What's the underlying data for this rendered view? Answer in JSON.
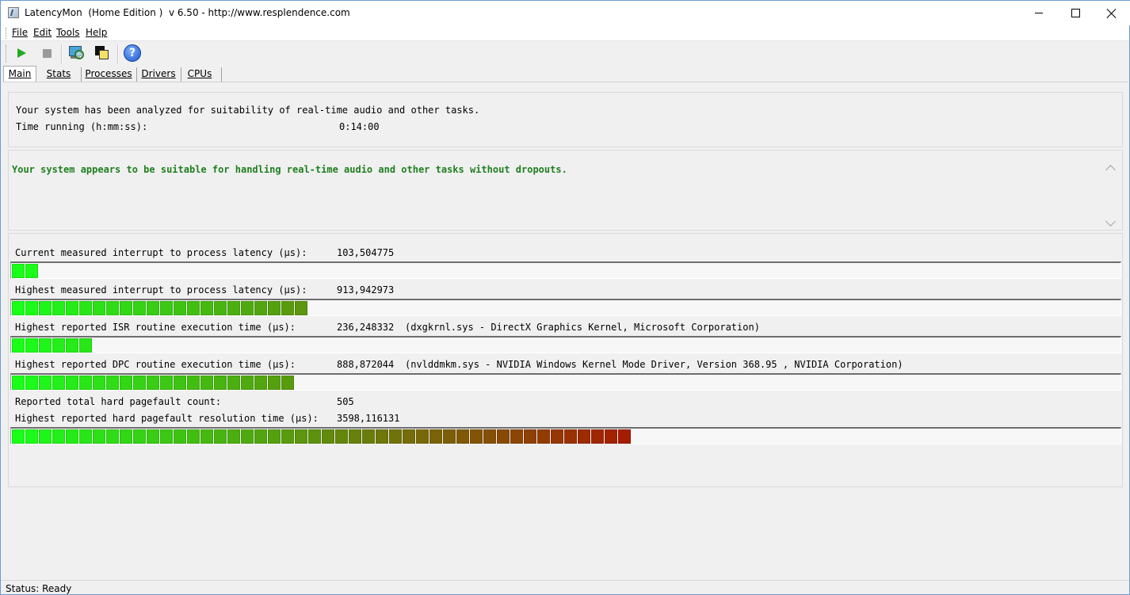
{
  "window": {
    "title": "LatencyMon  (Home Edition )  v 6.50 - http://www.resplendence.com"
  },
  "menu": [
    {
      "label": "File"
    },
    {
      "label": "Edit"
    },
    {
      "label": "Tools"
    },
    {
      "label": "Help"
    }
  ],
  "toolbar": {
    "buttons": [
      {
        "icon": "play-icon"
      },
      {
        "icon": "stop-icon"
      },
      {
        "icon": "monitor-magnifier-icon"
      },
      {
        "icon": "windows-icon"
      },
      {
        "icon": "help-icon",
        "glyph": "?"
      }
    ]
  },
  "tabs": [
    {
      "label": "Main",
      "active": true
    },
    {
      "label": "Stats"
    },
    {
      "label": "Processes"
    },
    {
      "label": "Drivers"
    },
    {
      "label": "CPUs"
    }
  ],
  "summary": {
    "analyzed_text": "Your system has been analyzed for suitability of real-time audio and other tasks.",
    "time_running_label": "Time running (h:mm:ss):",
    "time_running_value": "0:14:00"
  },
  "verdict": {
    "text": "Your system appears to be suitable for handling real-time audio and other tasks without dropouts.",
    "color": "#1f7f1f"
  },
  "metrics": [
    {
      "label": "Current measured interrupt to process latency (µs):",
      "value": "103,504775",
      "bar_segments": 2
    },
    {
      "label": "Highest measured interrupt to process latency (µs):",
      "value": "913,942973",
      "bar_segments": 22
    },
    {
      "label": "Highest reported ISR routine execution time (µs):",
      "value": "236,248332",
      "driver": "(dxgkrnl.sys - DirectX Graphics Kernel, Microsoft Corporation)",
      "bar_segments": 6
    },
    {
      "label": "Highest reported DPC routine execution time (µs):",
      "value": "888,872044",
      "driver": "(nvlddmkm.sys - NVIDIA Windows Kernel Mode Driver, Version 368.95 , NVIDIA Corporation)",
      "bar_segments": 21
    },
    {
      "label": "Reported total hard pagefault count:",
      "value": "505"
    },
    {
      "label": "Highest reported hard pagefault resolution time (µs):",
      "value": "3598,116131",
      "bar_segments": 46
    }
  ],
  "bar_colors": {
    "start": "#1aff1a",
    "end": "#a51d00",
    "scale_segments": 46
  },
  "status": {
    "text": "Status: Ready"
  }
}
